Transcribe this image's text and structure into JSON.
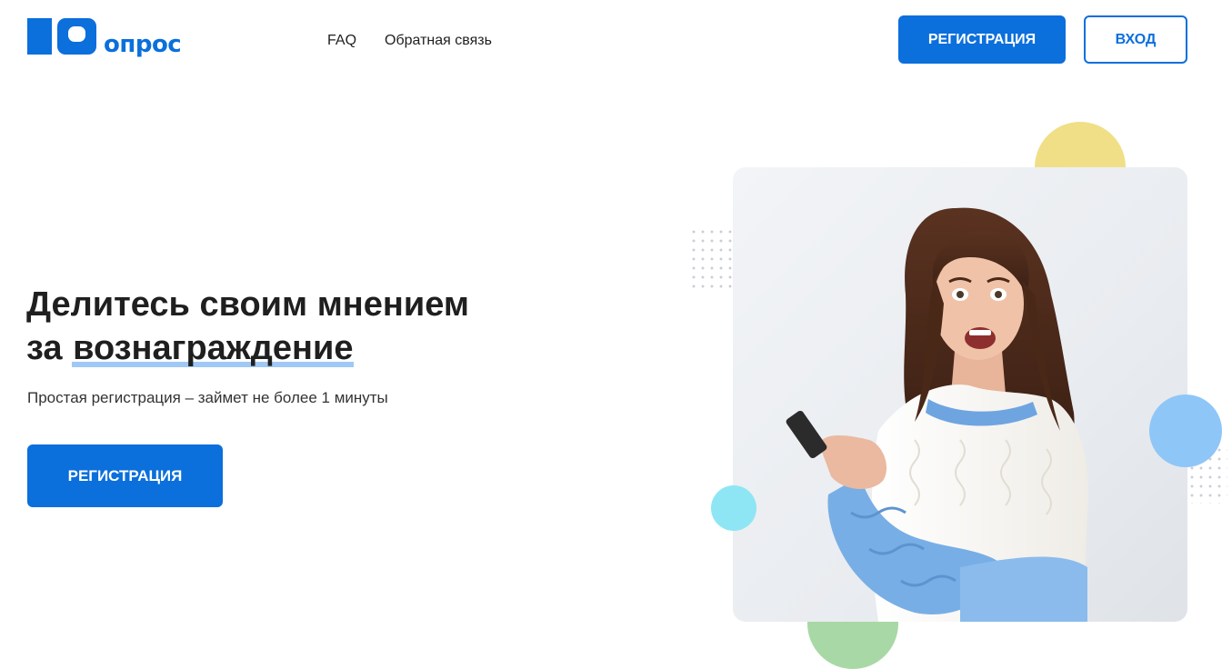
{
  "header": {
    "logo": {
      "text": "опрос",
      "brand_color": "#0b6fdc"
    },
    "nav": [
      {
        "label": "FAQ"
      },
      {
        "label": "Обратная связь"
      }
    ],
    "register_label": "Регистрация",
    "login_label": "Вход"
  },
  "hero": {
    "title_line1": "Делитесь своим мнением",
    "title_line2_prefix": "за",
    "title_line2_highlight": "вознаграждение",
    "subtitle": "Простая регистрация – займет не более 1 минуты",
    "cta_label": "Регистрация"
  },
  "colors": {
    "accent": "#0b6fdc",
    "highlight": "#9fc8f5",
    "decor_yellow": "#f0df86",
    "decor_blue": "#8ec6f7",
    "decor_cyan": "#8ee6f4",
    "decor_green": "#a8d8a6"
  }
}
